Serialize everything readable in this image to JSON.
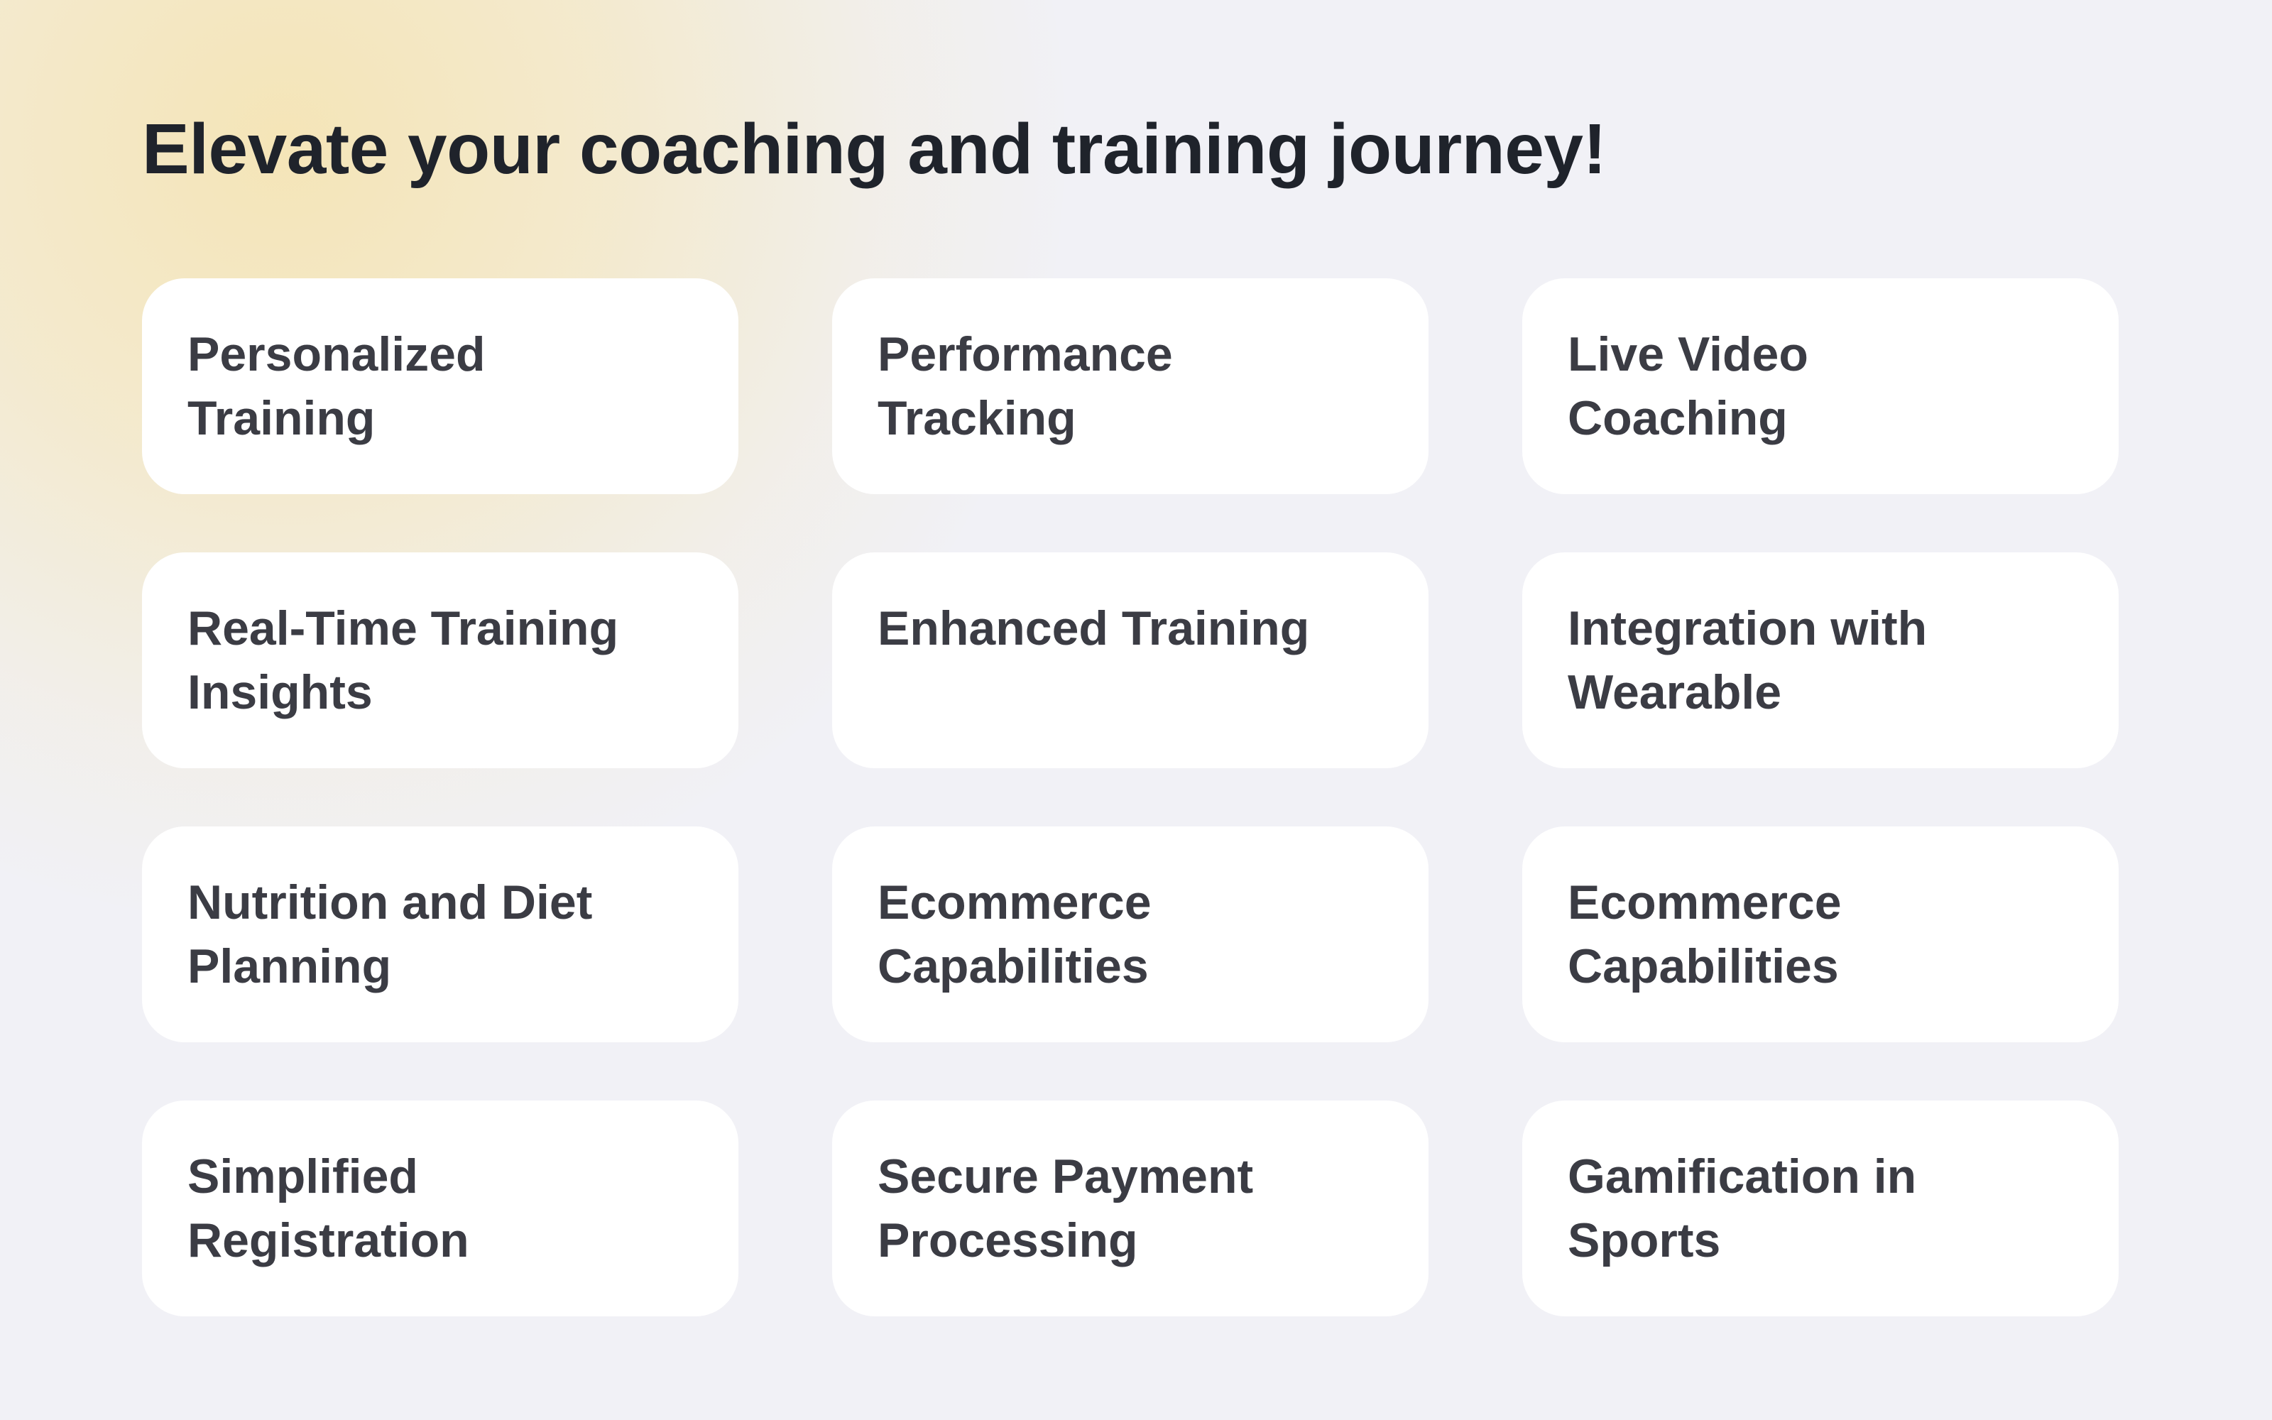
{
  "page": {
    "title": "Elevate your coaching and training journey!"
  },
  "features": [
    {
      "label": "Personalized Training"
    },
    {
      "label": "Performance Tracking"
    },
    {
      "label": "Live Video Coaching"
    },
    {
      "label": "Real-Time Training Insights"
    },
    {
      "label": "Enhanced Training"
    },
    {
      "label": "Integration with Wearable"
    },
    {
      "label": "Nutrition and Diet Planning"
    },
    {
      "label": "Ecommerce Capabilities"
    },
    {
      "label": "Ecommerce Capabilities"
    },
    {
      "label": "Simplified Registration"
    },
    {
      "label": "Secure Payment Processing"
    },
    {
      "label": "Gamification in Sports"
    }
  ],
  "colors": {
    "background": "#f1f1f6",
    "glow": "#f5e4b4",
    "title": "#1f232b",
    "card": "#ffffff",
    "card_text": "#3b3c44"
  }
}
